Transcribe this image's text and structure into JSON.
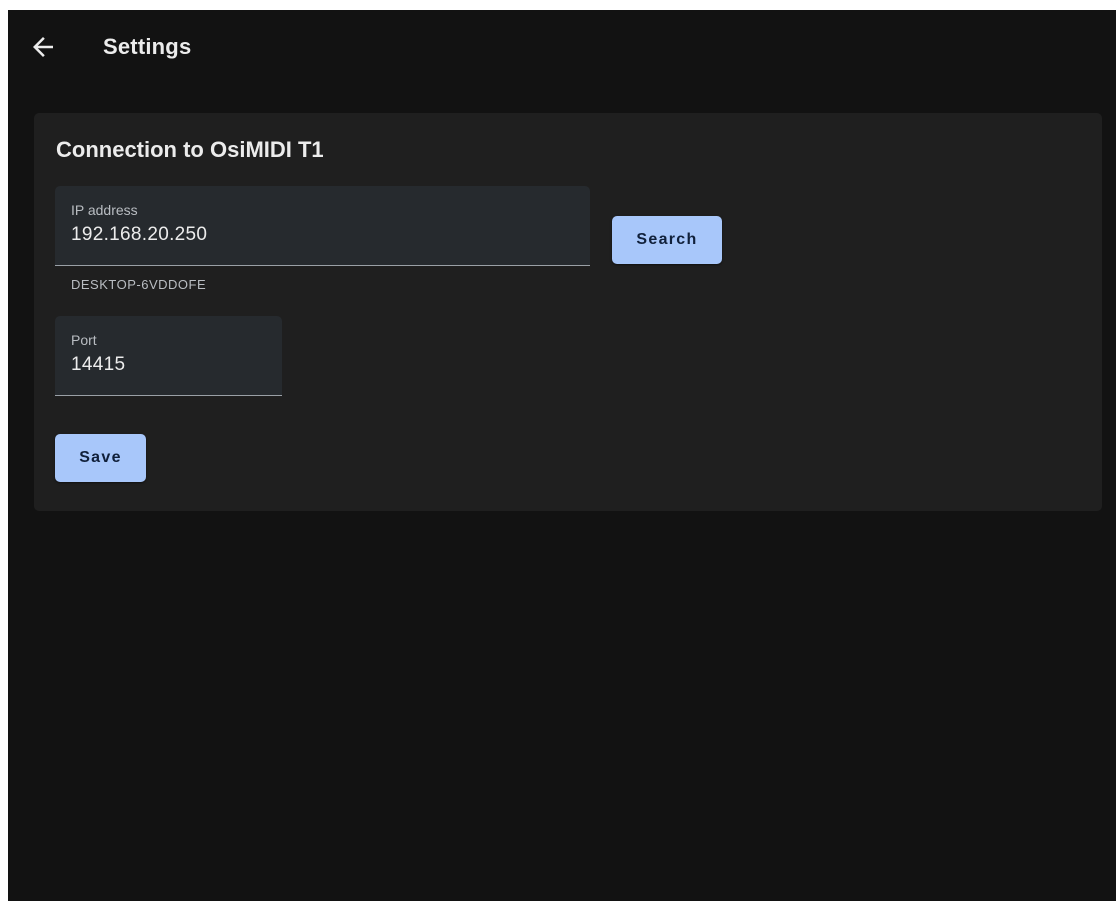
{
  "appbar": {
    "back_icon": "arrow-left-icon",
    "title": "Settings"
  },
  "card": {
    "title": "Connection to OsiMIDI T1",
    "ip_field": {
      "label": "IP address",
      "value": "192.168.20.250",
      "helper": "DESKTOP-6VDDOFE"
    },
    "search_label": "Search",
    "port_field": {
      "label": "Port",
      "value": "14415"
    },
    "save_label": "Save"
  },
  "colors": {
    "background": "#121212",
    "card": "#1f1f1f",
    "field": "#262a2e",
    "button": "#a8c7fa"
  }
}
